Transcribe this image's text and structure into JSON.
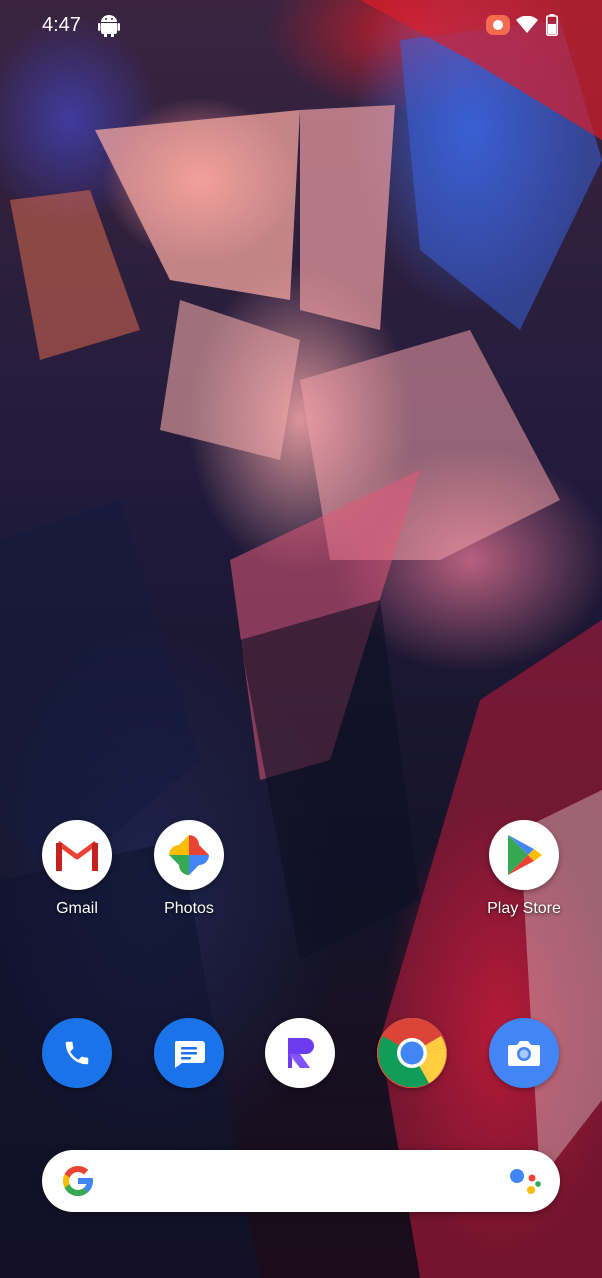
{
  "status_bar": {
    "time": "4:47",
    "icons": [
      "android-icon",
      "screen-record-icon",
      "wifi-icon",
      "battery-icon"
    ]
  },
  "home_apps": [
    {
      "label": "Gmail",
      "icon": "gmail-icon"
    },
    {
      "label": "Photos",
      "icon": "photos-icon"
    },
    {
      "label": "Play Store",
      "icon": "play-store-icon"
    }
  ],
  "dock_apps": [
    {
      "icon": "phone-icon",
      "color": "#1a73e8"
    },
    {
      "icon": "messages-icon",
      "color": "#1a73e8"
    },
    {
      "icon": "app-r-icon",
      "color": "#6c3cf0"
    },
    {
      "icon": "chrome-icon"
    },
    {
      "icon": "camera-icon",
      "color": "#4285f4"
    }
  ],
  "search": {
    "logo": "google-g-icon",
    "assistant": "google-assistant-icon"
  },
  "colors": {
    "google_blue": "#4285F4",
    "google_red": "#EA4335",
    "google_yellow": "#FBBC05",
    "google_green": "#34A853"
  }
}
